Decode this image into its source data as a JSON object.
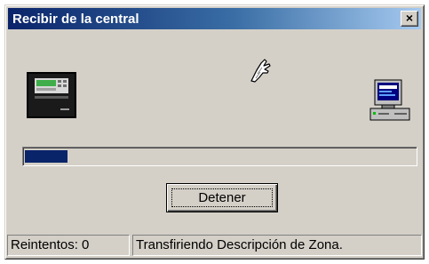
{
  "window": {
    "title": "Recibir de la central",
    "close_label": "×"
  },
  "icons": {
    "panel": "fire-alarm-panel-icon",
    "transfer": "hand-pointer-icon",
    "computer": "computer-icon"
  },
  "progress": {
    "fraction": 0.11
  },
  "actions": {
    "stop_label": "Detener"
  },
  "status": {
    "retries": "Reintentos: 0",
    "message": "Transfiriendo Descripción de Zona."
  },
  "colors": {
    "title_start": "#0a246a",
    "title_end": "#a6caf0",
    "progress_fill": "#0a246a",
    "face": "#d4d0c8"
  }
}
